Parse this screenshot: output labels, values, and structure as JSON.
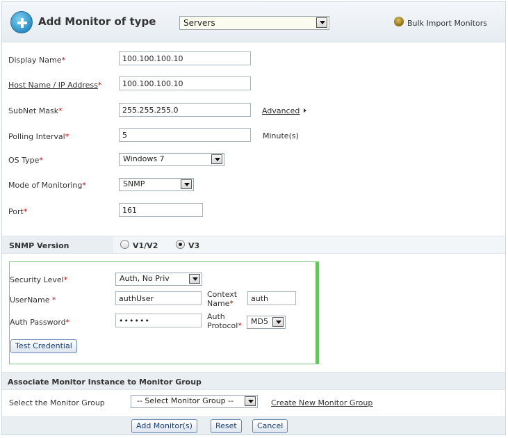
{
  "header": {
    "title": "Add Monitor of type",
    "monitor_type": "Servers",
    "bulk_import": "Bulk Import Monitors"
  },
  "form": {
    "display_name": {
      "label": "Display Name",
      "value": "100.100.100.10"
    },
    "host_name": {
      "label": "Host Name / IP Address",
      "value": "100.100.100.10"
    },
    "subnet_mask": {
      "label": "SubNet Mask",
      "value": "255.255.255.0",
      "advanced": "Advanced"
    },
    "polling_interval": {
      "label": "Polling Interval",
      "value": "5",
      "unit": "Minute(s)"
    },
    "os_type": {
      "label": "OS Type",
      "value": "Windows 7"
    },
    "mode": {
      "label": "Mode of Monitoring",
      "value": "SNMP"
    },
    "port": {
      "label": "Port",
      "value": "161"
    },
    "required_mark": "*"
  },
  "snmp": {
    "section_label": "SNMP Version",
    "v1v2_label": "V1/V2",
    "v3_label": "V3",
    "selected": "V3",
    "security_level": {
      "label": "Security Level",
      "value": "Auth, No Priv"
    },
    "username": {
      "label": "UserName",
      "value": "authUser"
    },
    "context_name": {
      "label_1": "Context",
      "label_2": "Name",
      "value": "auth"
    },
    "auth_password": {
      "label": "Auth Password",
      "value": "••••••"
    },
    "auth_protocol": {
      "label_1": "Auth",
      "label_2": "Protocol",
      "value": "MD5"
    },
    "test_button": "Test Credential"
  },
  "group": {
    "section_label": "Associate Monitor Instance to Monitor Group",
    "select_label": "Select the Monitor Group",
    "select_value": "-- Select Monitor Group --",
    "create_link": "Create New Monitor Group"
  },
  "footer": {
    "add_button": "Add Monitor(s)",
    "reset_button": "Reset",
    "cancel_button": "Cancel"
  },
  "colors": {
    "required": "#d10000",
    "snmp_box_border": "#66c35e",
    "band_bg": "#e9eef3",
    "button_text": "#1b3c6b"
  }
}
